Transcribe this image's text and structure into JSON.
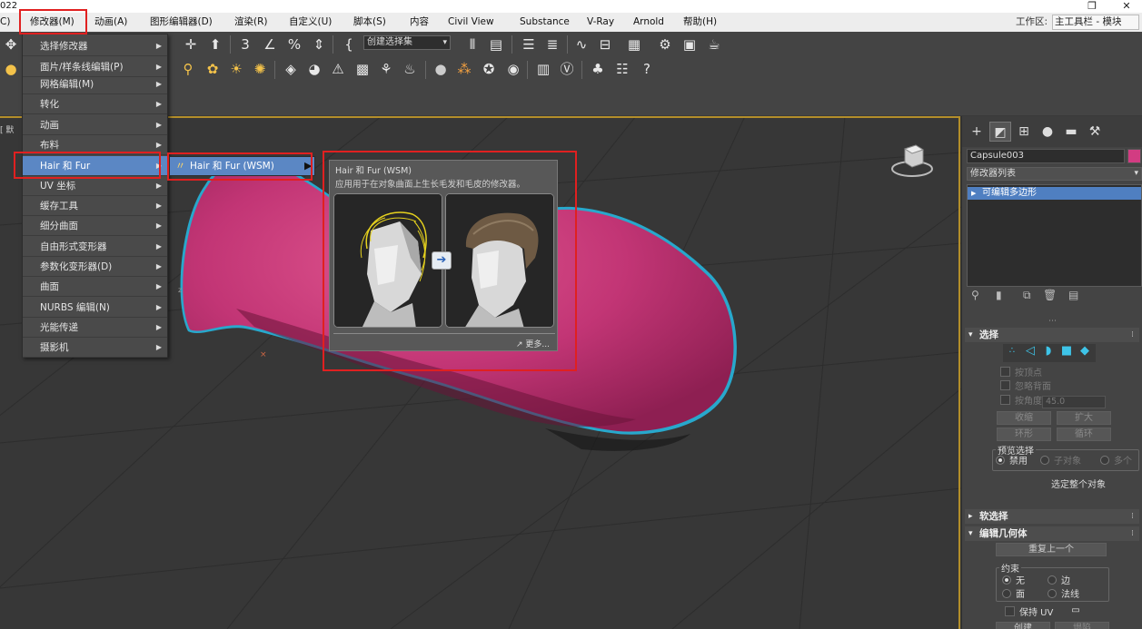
{
  "app": {
    "title_fragment": "022"
  },
  "window_controls": {
    "maximize": "❐",
    "close": "✕"
  },
  "menubar": {
    "items": [
      "C)",
      "修改器(M)",
      "动画(A)",
      "图形编辑器(D)",
      "渲染(R)",
      "自定义(U)",
      "脚本(S)",
      "内容",
      "Civil View",
      "Substance",
      "V-Ray",
      "Arnold",
      "帮助(H)"
    ],
    "workspace_label": "工作区:",
    "workspace_value": "主工具栏 - 模块"
  },
  "toolbar": {
    "selection_set_placeholder": "创建选择集"
  },
  "viewport": {
    "label": "[ 默",
    "axis_label": "z"
  },
  "modifiers_menu": {
    "items": [
      {
        "label": "选择修改器",
        "has_sub": true
      },
      {
        "label": "面片/样条线编辑(P)",
        "has_sub": true
      },
      {
        "label": "网格编辑(M)",
        "has_sub": true
      },
      {
        "label": "转化",
        "has_sub": true
      },
      {
        "label": "动画",
        "has_sub": true
      },
      {
        "label": "布料",
        "has_sub": true
      },
      {
        "label": "Hair 和 Fur",
        "has_sub": true,
        "highlighted": true
      },
      {
        "label": "UV 坐标",
        "has_sub": true
      },
      {
        "label": "缓存工具",
        "has_sub": true
      },
      {
        "label": "细分曲面",
        "has_sub": true
      },
      {
        "label": "自由形式变形器",
        "has_sub": true
      },
      {
        "label": "参数化变形器(D)",
        "has_sub": true
      },
      {
        "label": "曲面",
        "has_sub": true
      },
      {
        "label": "NURBS 编辑(N)",
        "has_sub": true
      },
      {
        "label": "光能传递",
        "has_sub": true
      },
      {
        "label": "摄影机",
        "has_sub": true
      }
    ],
    "submenu_item": "Hair 和 Fur (WSM)"
  },
  "tooltip": {
    "title": "Hair 和 Fur (WSM)",
    "description": "应用用于在对象曲面上生长毛发和毛皮的修改器。",
    "more_link": "更多..."
  },
  "command_panel": {
    "object_name": "Capsule003",
    "object_color": "#d23c82",
    "modifier_list": "修改器列表",
    "stack_items": [
      "可编辑多边形"
    ],
    "selection_rollout": {
      "title": "选择",
      "by_vertex": "按顶点",
      "ignore_backfacing": "忽略背面",
      "by_angle": "按角度",
      "angle_value": "45.0",
      "shrink": "收缩",
      "grow": "扩大",
      "ring": "环形",
      "loop": "循环",
      "preview_title": "预览选择",
      "preview_options": [
        "禁用",
        "子对象",
        "多个"
      ],
      "preview_selected": "禁用",
      "select_whole": "选定整个对象"
    },
    "soft_selection_title": "软选择",
    "edit_geometry": {
      "title": "编辑几何体",
      "repeat_last": "重复上一个",
      "constraints_title": "约束",
      "constraint_options": [
        "无",
        "边",
        "面",
        "法线"
      ],
      "constraint_selected": "无",
      "preserve_uv": "保持 UV",
      "create": "创建",
      "collapse": "塌陷"
    }
  }
}
